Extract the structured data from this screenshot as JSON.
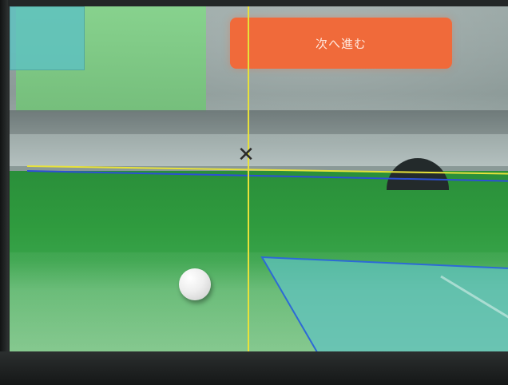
{
  "screen": {
    "next_button_label": "次へ進む"
  },
  "overlay": {
    "guide_color": "#e8e23a",
    "zone_color": "#2d4fd6",
    "crosshair_glyph": "✕"
  },
  "icons": {
    "crosshair": "close-x-icon",
    "ball": "golf-ball-icon"
  }
}
